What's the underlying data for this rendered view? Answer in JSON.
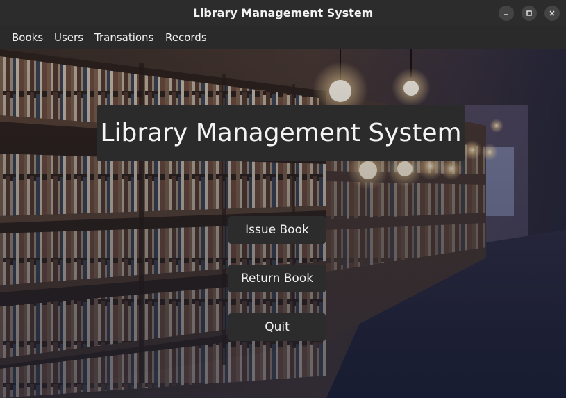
{
  "window": {
    "title": "Library Management System",
    "controls": [
      "minimize-icon",
      "maximize-icon",
      "close-icon"
    ]
  },
  "menubar": {
    "items": [
      {
        "label": "Books"
      },
      {
        "label": "Users"
      },
      {
        "label": "Transations"
      },
      {
        "label": "Records"
      }
    ]
  },
  "main": {
    "heading": "Library Management System",
    "buttons": [
      {
        "label": "Issue Book"
      },
      {
        "label": "Return Book"
      },
      {
        "label": "Quit"
      }
    ]
  },
  "colors": {
    "titlebar": "#2c2c2c",
    "menubar": "#2a2a2a",
    "button_bg": "#2c2c2c",
    "text": "#f2f2f2"
  }
}
